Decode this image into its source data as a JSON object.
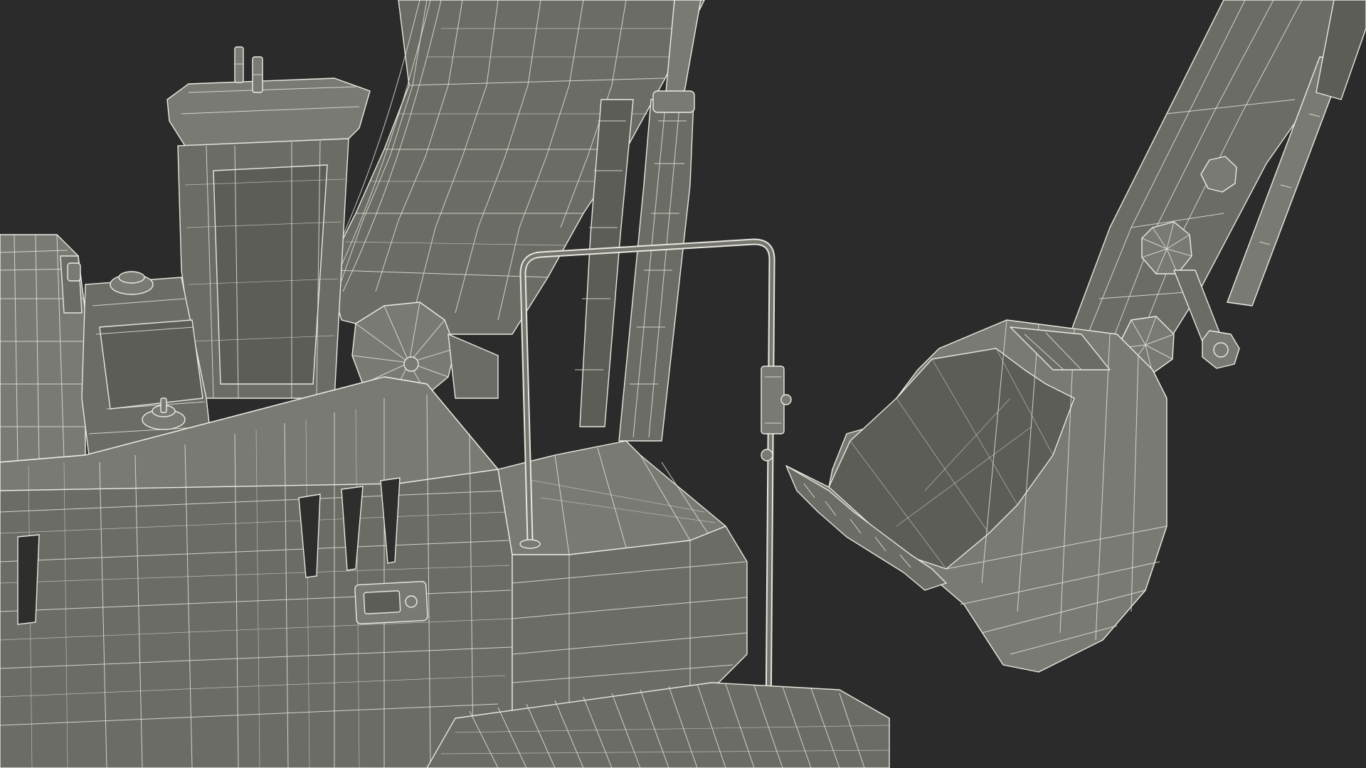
{
  "scene": {
    "background_color": "#2b2b2b",
    "mesh_fill_color": "#6c6c66",
    "wire_color": "#e8e8e0"
  }
}
